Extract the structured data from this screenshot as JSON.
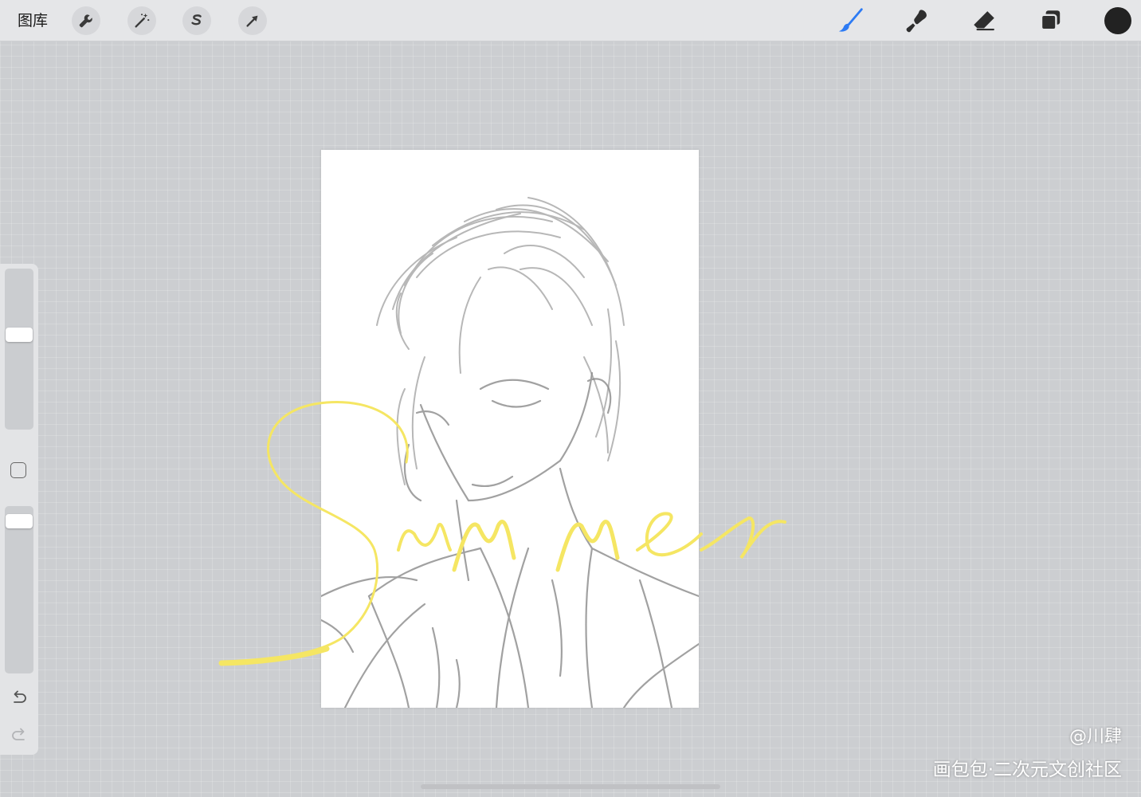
{
  "toolbar": {
    "gallery_label": "图库",
    "left_tools": [
      "wrench-icon",
      "magic-wand-icon",
      "selection-s-icon",
      "transform-arrow-icon"
    ],
    "right_tools": [
      "brush-icon",
      "smudge-icon",
      "eraser-icon",
      "layers-icon"
    ],
    "active_tool": "brush",
    "active_tool_color": "#2d7bf4",
    "current_color": "#222222"
  },
  "sidebar": {
    "brush_size_level": 0.6,
    "opacity_level": 0.95,
    "icons": [
      "modify-square-icon",
      "undo-icon",
      "redo-icon"
    ]
  },
  "canvas": {
    "background": "#ffffff",
    "lettering_color": "#f5e663",
    "sketch_color": "#8f8f8f"
  },
  "watermark": {
    "author": "@川肆",
    "site": "画包包·二次元文创社区"
  }
}
